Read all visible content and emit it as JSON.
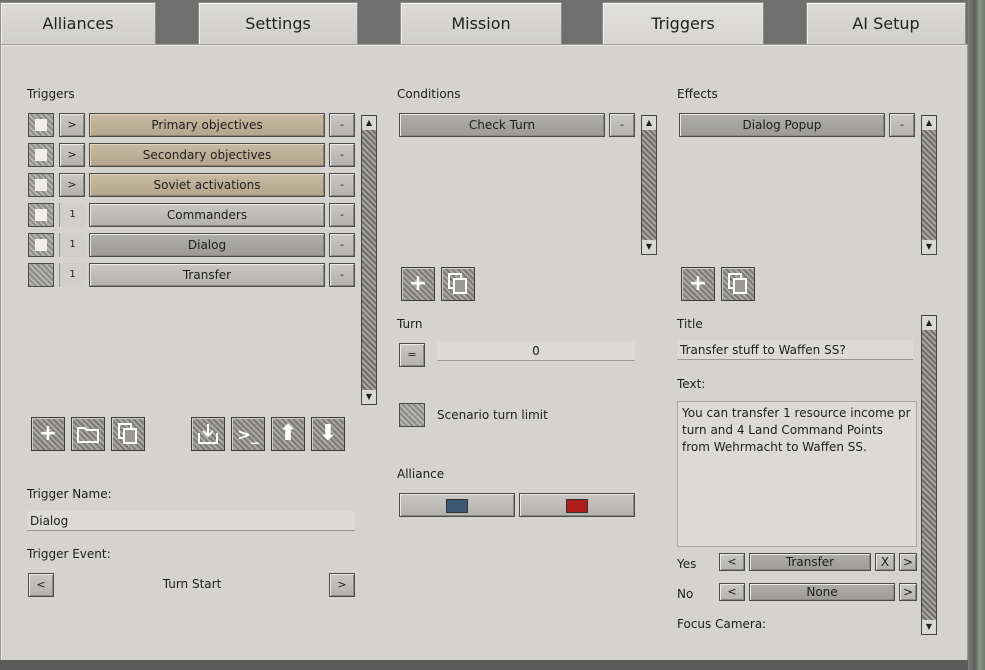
{
  "tabs": [
    {
      "label": "Alliances"
    },
    {
      "label": "Settings"
    },
    {
      "label": "Mission"
    },
    {
      "label": "Triggers",
      "active": true
    },
    {
      "label": "AI Setup"
    }
  ],
  "triggers": {
    "heading": "Triggers",
    "items": [
      {
        "expand": ">",
        "label": "Primary objectives",
        "remove": "-",
        "checked": true
      },
      {
        "expand": ">",
        "label": "Secondary objectives",
        "remove": "-",
        "checked": true
      },
      {
        "expand": ">",
        "label": "Soviet activations",
        "remove": "-",
        "checked": true
      },
      {
        "expand": "1",
        "label": "Commanders",
        "remove": "-",
        "checked": true
      },
      {
        "expand": "1",
        "label": "Dialog",
        "remove": "-",
        "checked": true
      },
      {
        "expand": "1",
        "label": "Transfer",
        "remove": "-",
        "checked": false
      }
    ],
    "name_label": "Trigger Name:",
    "name_value": "Dialog",
    "event_label": "Trigger Event:",
    "event_prev": "<",
    "event_value": "Turn Start",
    "event_next": ">"
  },
  "conditions": {
    "heading": "Conditions",
    "items": [
      {
        "label": "Check Turn",
        "remove": "-"
      }
    ],
    "turn_label": "Turn",
    "turn_op": "=",
    "turn_value": "0",
    "scenario_limit_label": "Scenario turn limit",
    "alliance_label": "Alliance",
    "alliance_colors": [
      "#3f5877",
      "#b01f1b"
    ]
  },
  "effects": {
    "heading": "Effects",
    "items": [
      {
        "label": "Dialog Popup",
        "remove": "-"
      }
    ],
    "title_label": "Title",
    "title_value": "Transfer stuff to Waffen SS?",
    "text_label": "Text:",
    "text_lines": [
      "You can transfer 1 resource income pr",
      "turn and 4 Land Command Points",
      "from Wehrmacht to Waffen SS."
    ],
    "yes_label": "Yes",
    "yes_prev": "<",
    "yes_value": "Transfer",
    "yes_clear": "X",
    "yes_next": ">",
    "no_label": "No",
    "no_prev": "<",
    "no_value": "None",
    "no_next": ">",
    "focus_label": "Focus Camera:"
  },
  "icons": {
    "add": "plus-icon",
    "duplicate": "copy-icon",
    "folder": "folder-icon",
    "import": "import-icon",
    "console": "console-icon",
    "move_up": "arrow-up-icon",
    "move_down": "arrow-down-icon"
  }
}
